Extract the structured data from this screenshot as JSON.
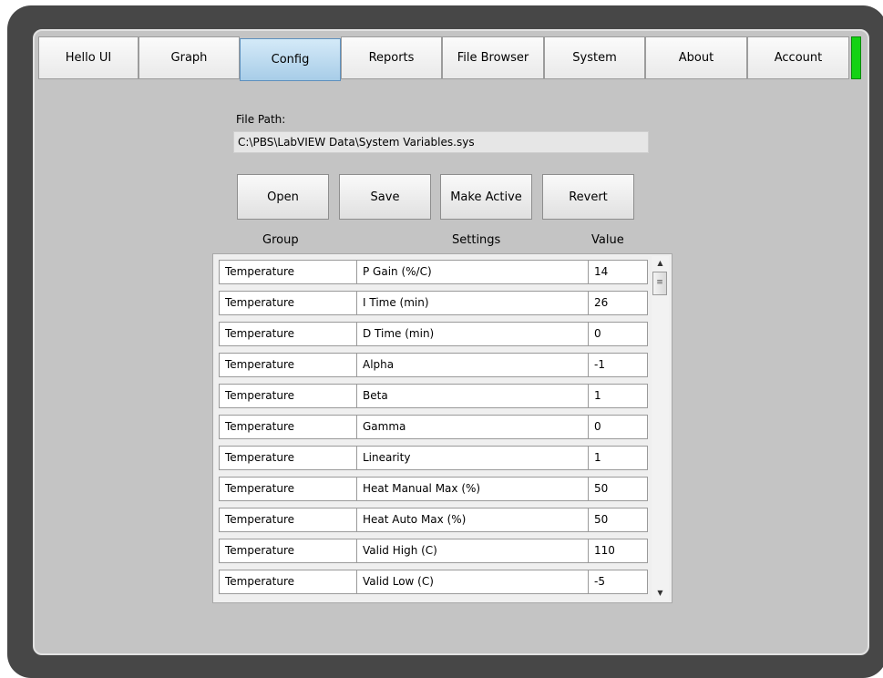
{
  "tabs": [
    {
      "label": "Hello UI"
    },
    {
      "label": "Graph"
    },
    {
      "label": "Config",
      "active": true
    },
    {
      "label": "Reports"
    },
    {
      "label": "File Browser"
    },
    {
      "label": "System"
    },
    {
      "label": "About"
    },
    {
      "label": "Account"
    }
  ],
  "status_color": "#14d214",
  "file_path": {
    "label": "File Path:",
    "value": "C:\\PBS\\LabVIEW Data\\System Variables.sys"
  },
  "buttons": {
    "open": "Open",
    "save": "Save",
    "make_active": "Make Active",
    "revert": "Revert"
  },
  "table": {
    "headers": {
      "group": "Group",
      "settings": "Settings",
      "value": "Value"
    },
    "rows": [
      {
        "group": "Temperature",
        "setting": "P Gain (%/C)",
        "value": "14"
      },
      {
        "group": "Temperature",
        "setting": "I Time (min)",
        "value": "26"
      },
      {
        "group": "Temperature",
        "setting": "D Time (min)",
        "value": "0"
      },
      {
        "group": "Temperature",
        "setting": "Alpha",
        "value": "-1"
      },
      {
        "group": "Temperature",
        "setting": "Beta",
        "value": "1"
      },
      {
        "group": "Temperature",
        "setting": "Gamma",
        "value": "0"
      },
      {
        "group": "Temperature",
        "setting": "Linearity",
        "value": "1"
      },
      {
        "group": "Temperature",
        "setting": "Heat Manual Max (%)",
        "value": "50"
      },
      {
        "group": "Temperature",
        "setting": "Heat Auto Max (%)",
        "value": "50"
      },
      {
        "group": "Temperature",
        "setting": "Valid High (C)",
        "value": "110"
      },
      {
        "group": "Temperature",
        "setting": "Valid Low (C)",
        "value": "-5"
      }
    ]
  },
  "icons": {
    "scroll_up": "▲",
    "scroll_down": "▼",
    "scroll_grip": "≡"
  }
}
